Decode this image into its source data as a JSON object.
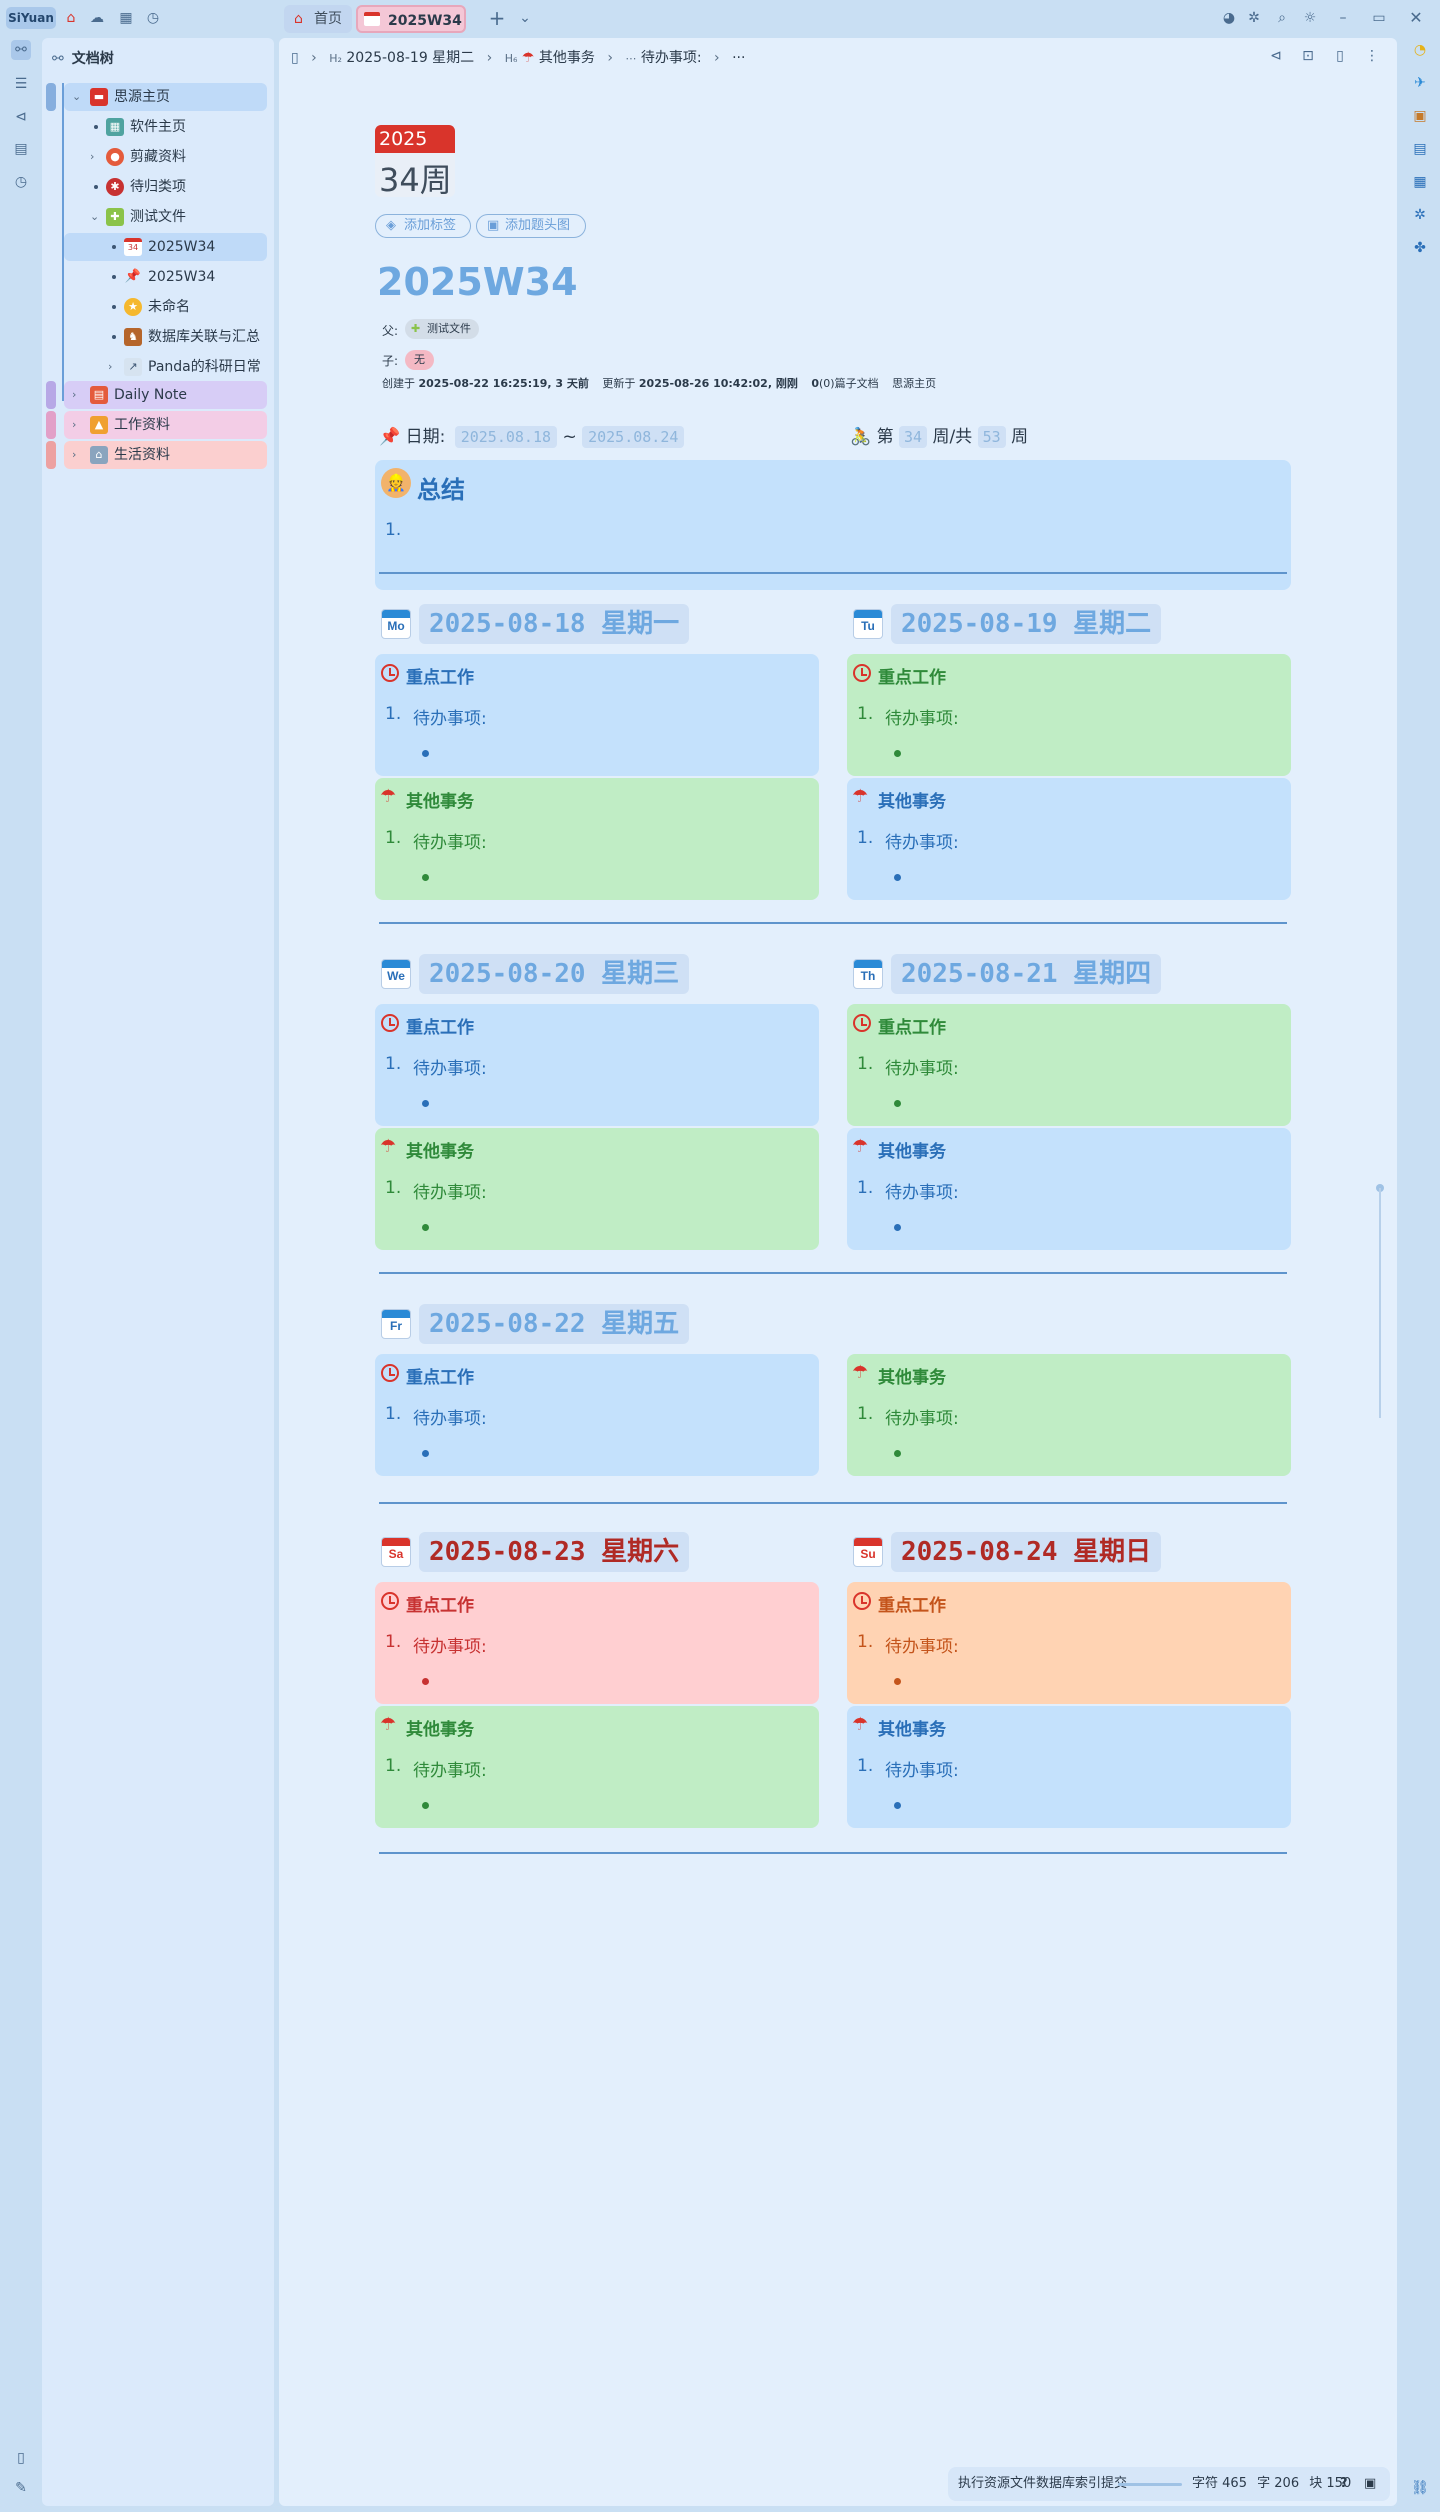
{
  "app": {
    "brand": "SiYuan"
  },
  "tabs": [
    {
      "label": "首页"
    },
    {
      "label": "2025W34"
    }
  ],
  "sidebar": {
    "title": "文档树",
    "items": [
      {
        "label": "思源主页",
        "level": 0
      },
      {
        "label": "软件主页",
        "level": 1
      },
      {
        "label": "剪藏资料",
        "level": 1
      },
      {
        "label": "待归类项",
        "level": 1
      },
      {
        "label": "测试文件",
        "level": 1
      },
      {
        "label": "2025W34",
        "level": 2
      },
      {
        "label": "2025W34",
        "level": 2
      },
      {
        "label": "未命名",
        "level": 2
      },
      {
        "label": "数据库关联与汇总",
        "level": 2
      },
      {
        "label": "Panda的科研日常",
        "level": 2
      },
      {
        "label": "Daily Note",
        "level": 0
      },
      {
        "label": "工作资料",
        "level": 0
      },
      {
        "label": "生活资料",
        "level": 0
      }
    ]
  },
  "breadcrumb": {
    "h2": "2025-08-19 星期二",
    "h6": "其他事务",
    "item": "待办事项:",
    "more": "···"
  },
  "doc": {
    "icon_year": "2025",
    "icon_week": "34周",
    "add_tag": "添加标签",
    "add_cover": "添加题头图",
    "title": "2025W34",
    "parent_label": "父:",
    "parent_value": "测试文件",
    "child_label": "子:",
    "child_value": "无",
    "meta": {
      "created_label": "创建于",
      "created": "2025-08-22 16:25:19, 3 天前",
      "updated_label": "更新于",
      "updated": "2025-08-26 10:42:02, 刚刚",
      "refs": "0",
      "refs_label": "(0)篇子文档",
      "home": "思源主页"
    },
    "date_label": "日期:",
    "date_start": "2025.08.18",
    "tilde": "~",
    "date_end": "2025.08.24",
    "week_prefix": "第",
    "week_num": "34",
    "week_mid": "周/共",
    "week_total": "53",
    "week_suffix": "周",
    "summary_title": "总结",
    "summary_item": "1."
  },
  "sections": {
    "key_work": "重点工作",
    "other": "其他事务",
    "todo": "待办事项:",
    "num": "1."
  },
  "days": [
    {
      "abbr": "Mo",
      "title": "2025-08-18 星期一"
    },
    {
      "abbr": "Tu",
      "title": "2025-08-19 星期二"
    },
    {
      "abbr": "We",
      "title": "2025-08-20 星期三"
    },
    {
      "abbr": "Th",
      "title": "2025-08-21 星期四"
    },
    {
      "abbr": "Fr",
      "title": "2025-08-22 星期五"
    },
    {
      "abbr": "Sa",
      "title": "2025-08-23 星期六"
    },
    {
      "abbr": "Su",
      "title": "2025-08-24 星期日"
    }
  ],
  "status": {
    "task": "执行资源文件数据库索引提交",
    "chars_label": "字符",
    "chars": "465",
    "words_label": "字",
    "words": "206",
    "blocks_label": "块",
    "blocks": "150",
    "help": "?"
  },
  "colors": {
    "accent": "#4a8bd6",
    "title_blue": "#6ea8e0",
    "red": "#d9342b",
    "green_text": "#2f8a3a",
    "blue_text": "#2a6fb8"
  }
}
